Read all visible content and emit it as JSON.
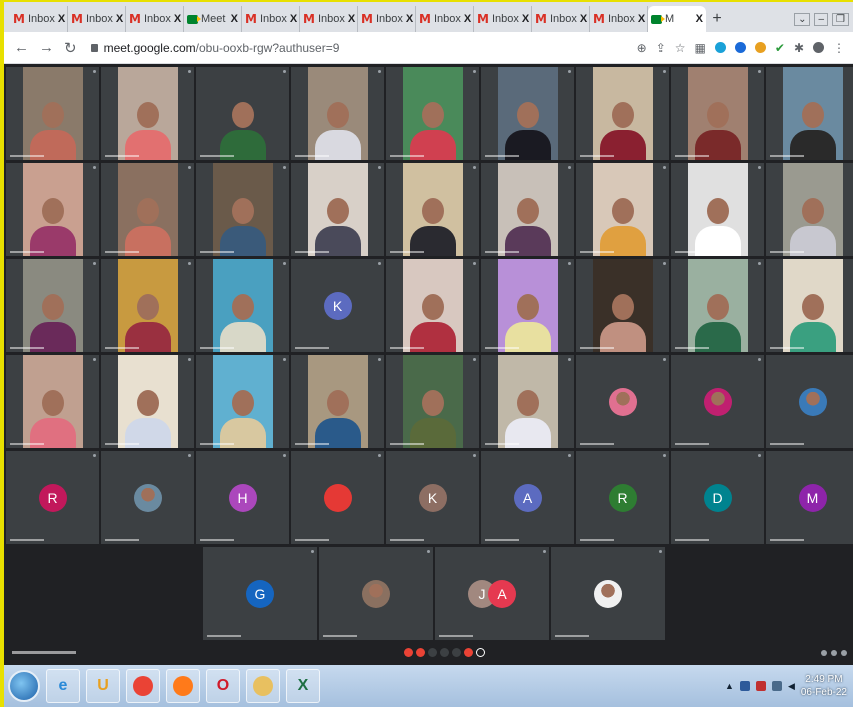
{
  "browser": {
    "tabs": [
      {
        "label": "Inbox",
        "icon": "gmail-icon",
        "active": false
      },
      {
        "label": "Inbox",
        "icon": "gmail-icon",
        "active": false
      },
      {
        "label": "Inbox",
        "icon": "gmail-icon",
        "active": false
      },
      {
        "label": "Meet",
        "icon": "google-meet-icon",
        "active": false
      },
      {
        "label": "Inbox",
        "icon": "gmail-icon",
        "active": false
      },
      {
        "label": "Inbox",
        "icon": "gmail-icon",
        "active": false
      },
      {
        "label": "Inbox",
        "icon": "gmail-icon",
        "active": false
      },
      {
        "label": "Inbox",
        "icon": "gmail-icon",
        "active": false
      },
      {
        "label": "Inbox",
        "icon": "gmail-icon",
        "active": false
      },
      {
        "label": "Inbox",
        "icon": "gmail-icon",
        "active": false
      },
      {
        "label": "Inbox",
        "icon": "gmail-icon",
        "active": false
      },
      {
        "label": "M",
        "icon": "google-meet-icon",
        "active": true
      }
    ],
    "tab_close": "X",
    "new_tab": "+",
    "url_host": "meet.google.com",
    "url_path": "/obu-oo",
    "url_rest": "xb-rgw?authuser=9"
  },
  "meeting": {
    "tiles": [
      {
        "type": "video",
        "bg": "#8a7a6a",
        "shirt": "#c06a5a"
      },
      {
        "type": "video",
        "bg": "#b9a79a",
        "shirt": "#e27070"
      },
      {
        "type": "video",
        "bg": "#3c4043",
        "shirt": "#2e6b3a"
      },
      {
        "type": "video",
        "bg": "#9a8a7a",
        "shirt": "#d9d9e0"
      },
      {
        "type": "video",
        "bg": "#4a8a5a",
        "shirt": "#d04050"
      },
      {
        "type": "video",
        "bg": "#5a6a7a",
        "shirt": "#1a1a22"
      },
      {
        "type": "video",
        "bg": "#c8b8a0",
        "shirt": "#8a2030"
      },
      {
        "type": "video",
        "bg": "#a08070",
        "shirt": "#7a2a2a"
      },
      {
        "type": "video",
        "bg": "#6a8aa0",
        "shirt": "#2a2a2a"
      },
      {
        "type": "video",
        "bg": "#c9a090",
        "shirt": "#9a3a6a"
      },
      {
        "type": "video",
        "bg": "#8a7060",
        "shirt": "#c87060"
      },
      {
        "type": "video",
        "bg": "#6a5a4a",
        "shirt": "#3a5a7a"
      },
      {
        "type": "video",
        "bg": "#d8d0c8",
        "shirt": "#4a4a5a"
      },
      {
        "type": "video",
        "bg": "#d0c0a0",
        "shirt": "#2a2a30"
      },
      {
        "type": "video",
        "bg": "#c8c0b8",
        "shirt": "#5a3a5a"
      },
      {
        "type": "video",
        "bg": "#d8c8b8",
        "shirt": "#e0a040"
      },
      {
        "type": "video",
        "bg": "#e0e0e0",
        "shirt": "#ffffff"
      },
      {
        "type": "video",
        "bg": "#9a9a90",
        "shirt": "#c8c8d0"
      },
      {
        "type": "video",
        "bg": "#8a8a80",
        "shirt": "#6a2a5a"
      },
      {
        "type": "video",
        "bg": "#c89a40",
        "shirt": "#9a3040"
      },
      {
        "type": "video",
        "bg": "#4aa0c0",
        "shirt": "#d8d8c8"
      },
      {
        "type": "avatar",
        "letter": "K",
        "color": "#5c6bc0"
      },
      {
        "type": "video",
        "bg": "#d8c8c0",
        "shirt": "#b03040"
      },
      {
        "type": "video",
        "bg": "#b890d8",
        "shirt": "#e8e0a0"
      },
      {
        "type": "video",
        "bg": "#3a3028",
        "shirt": "#c09080"
      },
      {
        "type": "video",
        "bg": "#9ab0a0",
        "shirt": "#2a6a4a"
      },
      {
        "type": "video",
        "bg": "#e0d8c8",
        "shirt": "#3aa080"
      },
      {
        "type": "video",
        "bg": "#c0a090",
        "shirt": "#e07080"
      },
      {
        "type": "video",
        "bg": "#e8e0d0",
        "shirt": "#d0d8e8"
      },
      {
        "type": "video",
        "bg": "#60b0d0",
        "shirt": "#d8c8a0"
      },
      {
        "type": "video",
        "bg": "#a89880",
        "shirt": "#2a5a8a"
      },
      {
        "type": "video",
        "bg": "#4a6a4a",
        "shirt": "#5a6a3a"
      },
      {
        "type": "video",
        "bg": "#c0b8a8",
        "shirt": "#e8e8f0"
      },
      {
        "type": "photo",
        "color": "#e07090"
      },
      {
        "type": "photo",
        "color": "#c02070"
      },
      {
        "type": "photo",
        "color": "#3a7ab8"
      },
      {
        "type": "avatar",
        "letter": "R",
        "color": "#c2185b"
      },
      {
        "type": "photo",
        "color": "#6a8aa0"
      },
      {
        "type": "avatar",
        "letter": "H",
        "color": "#ab47bc"
      },
      {
        "type": "avatar",
        "letter": "",
        "color": "#e53935"
      },
      {
        "type": "avatar",
        "letter": "K",
        "color": "#8d6e63"
      },
      {
        "type": "avatar",
        "letter": "A",
        "color": "#5c6bc0"
      },
      {
        "type": "avatar",
        "letter": "R",
        "color": "#2e7d32"
      },
      {
        "type": "avatar",
        "letter": "D",
        "color": "#00838f"
      },
      {
        "type": "avatar",
        "letter": "M",
        "color": "#8e24aa"
      },
      {
        "type": "avatar",
        "letter": "G",
        "color": "#1565c0"
      },
      {
        "type": "photo",
        "color": "#8a7060"
      },
      {
        "type": "avatar2",
        "letter": "J",
        "letter2": "A",
        "color": "#a1887f",
        "color2": "#e53950"
      },
      {
        "type": "photo",
        "color": "#f0f0f0"
      }
    ]
  },
  "taskbar": {
    "apps": [
      {
        "name": "internet-explorer-icon",
        "glyph": "e",
        "color": "#2a8ad8"
      },
      {
        "name": "antivirus-icon",
        "glyph": "U",
        "color": "#e8a020"
      },
      {
        "name": "chrome-icon",
        "glyph": "",
        "color": "#ea4335"
      },
      {
        "name": "firefox-icon",
        "glyph": "",
        "color": "#ff7a1a"
      },
      {
        "name": "opera-icon",
        "glyph": "O",
        "color": "#d01a2a"
      },
      {
        "name": "file-explorer-icon",
        "glyph": "",
        "color": "#e8c060"
      },
      {
        "name": "excel-icon",
        "glyph": "X",
        "color": "#1d6f42"
      }
    ],
    "time": "2:49 PM",
    "date": "06-Feb-22"
  }
}
